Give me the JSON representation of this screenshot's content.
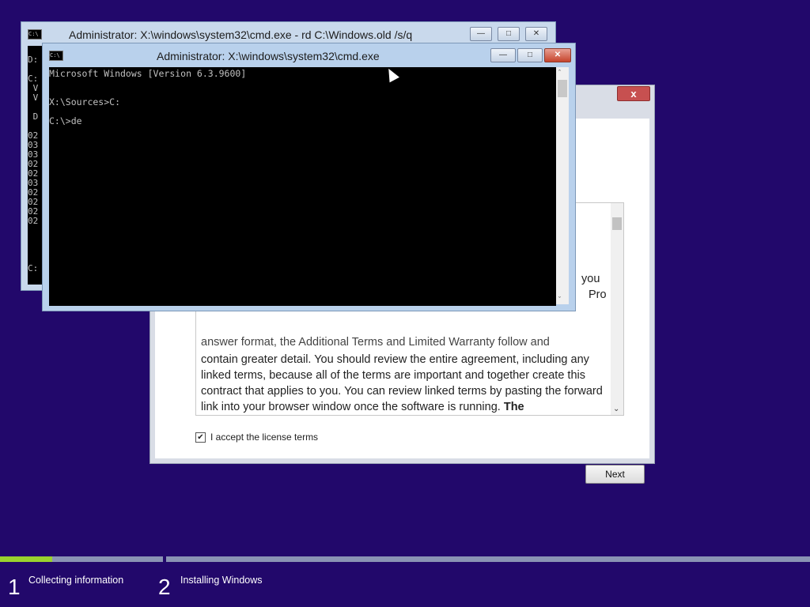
{
  "setup_dialog": {
    "close_label": "x",
    "license_fragments": [
      "you",
      "Pro"
    ],
    "license_partial_line": "answer format, the Additional Terms and Limited Warranty follow and",
    "license_text": "contain greater detail. You should review the entire agreement, including any linked terms, because all of the terms are important and together create this contract that applies to you. You can review linked terms by pasting the forward link into your browser window once the software is running.",
    "license_bold_tail": "The",
    "accept_checked": true,
    "accept_label": "I accept the license terms",
    "next_label": "Next"
  },
  "cmd_back": {
    "title": "Administrator: X:\\windows\\system32\\cmd.exe - rd  C:\\Windows.old /s/q",
    "visible_left_chars": [
      "",
      "D:",
      "",
      "C:",
      " V",
      " V",
      "",
      " D",
      "",
      "02",
      "03",
      "03",
      "02",
      "02",
      "03",
      "02",
      "02",
      "02",
      "02",
      "",
      "",
      "",
      "",
      "C:"
    ]
  },
  "cmd_front": {
    "title": "Administrator: X:\\windows\\system32\\cmd.exe",
    "lines": [
      "Microsoft Windows [Version 6.3.9600]",
      "",
      "",
      "X:\\Sources>C:",
      "",
      "C:\\>de"
    ]
  },
  "progress": {
    "fraction_complete": 0.32,
    "steps": [
      {
        "num": "1",
        "label": "Collecting information"
      },
      {
        "num": "2",
        "label": "Installing Windows"
      }
    ]
  },
  "colors": {
    "desktop": "#22086b",
    "progress_fill": "#9ad22e",
    "console_bg": "#000000"
  }
}
